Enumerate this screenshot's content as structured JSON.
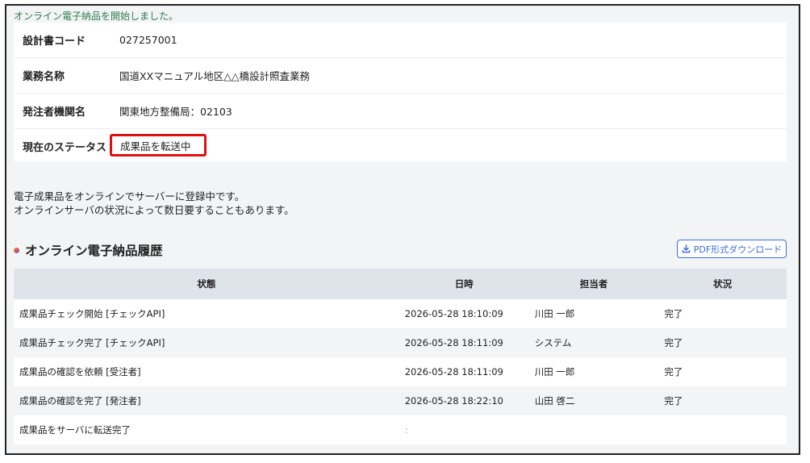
{
  "notice": "オンライン電子納品を開始しました。",
  "info": {
    "rows": [
      {
        "label": "設計書コード",
        "value": "027257001"
      },
      {
        "label": "業務名称",
        "value": "国道XXマニュアル地区△△橋設計照査業務"
      },
      {
        "label": "発注者機関名",
        "value": "関東地方整備局：02103"
      },
      {
        "label": "現在のステータス",
        "value": "成果品を転送中"
      }
    ]
  },
  "message": {
    "line1": "電子成果品をオンラインでサーバーに登録中です。",
    "line2": "オンラインサーバの状況によって数日要することもあります。"
  },
  "history": {
    "title": "オンライン電子納品履歴",
    "pdf_button_label": "PDF形式ダウンロード",
    "columns": [
      "状態",
      "日時",
      "担当者",
      "状況"
    ],
    "rows": [
      {
        "state": "成果品チェック開始 [チェックAPI]",
        "datetime": "2026-05-28 18:10:09",
        "person": "川田 一郎",
        "status": "完了"
      },
      {
        "state": "成果品チェック完了 [チェックAPI]",
        "datetime": "2026-05-28 18:11:09",
        "person": "システム",
        "status": "完了"
      },
      {
        "state": "成果品の確認を依頼 [受注者]",
        "datetime": "2026-05-28 18:11:09",
        "person": "川田 一郎",
        "status": "完了"
      },
      {
        "state": "成果品の確認を完了 [発注者]",
        "datetime": "2026-05-28 18:22:10",
        "person": "山田 啓二",
        "status": "完了"
      },
      {
        "state": "成果品をサーバに転送完了",
        "datetime": ":",
        "person": "",
        "status": ""
      }
    ]
  },
  "colors": {
    "notice": "#2e7d4f",
    "highlight": "#e01010",
    "accent": "#3a6fd8"
  },
  "icons": {
    "section_bullet": "gradient-dot-icon",
    "pdf_button": "download-icon"
  }
}
